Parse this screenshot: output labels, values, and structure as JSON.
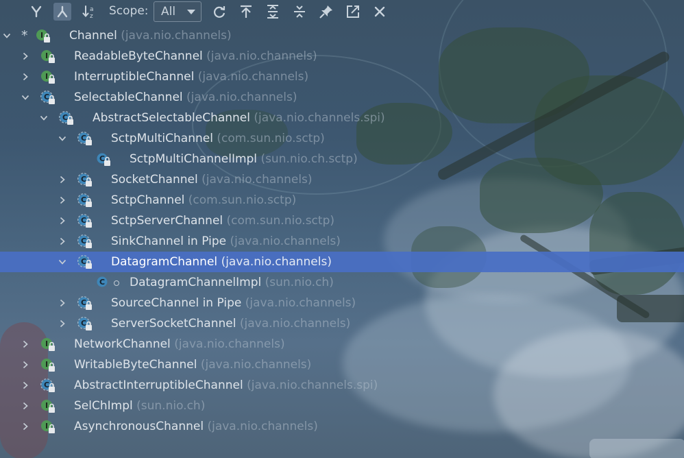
{
  "toolbar": {
    "buttons": [
      {
        "icon": "subtypes-hierarchy-icon"
      },
      {
        "icon": "supertypes-hierarchy-icon",
        "active": true
      },
      {
        "icon": "sort-alphabetically-icon"
      },
      {
        "icon": "refresh-icon"
      },
      {
        "icon": "base-on-this-class-icon"
      },
      {
        "icon": "expand-all-icon"
      },
      {
        "icon": "collapse-all-icon"
      },
      {
        "icon": "pin-tab-icon"
      },
      {
        "icon": "export-icon"
      },
      {
        "icon": "close-icon"
      }
    ],
    "scope_label": "Scope:",
    "scope_value": "All"
  },
  "colors": {
    "selection": "#496fc4",
    "interface_icon": "#4f9a55",
    "class_icon": "#3e86b8",
    "package_text": "#8c98a4"
  },
  "tree": [
    {
      "name": "Channel",
      "pkg": "(java.nio.channels)",
      "kind": "interface",
      "level": 0,
      "state": "expanded",
      "star": true
    },
    {
      "name": "ReadableByteChannel",
      "pkg": "(java.nio.channels)",
      "kind": "interface",
      "level": 1,
      "state": "collapsed"
    },
    {
      "name": "InterruptibleChannel",
      "pkg": "(java.nio.channels)",
      "kind": "interface",
      "level": 1,
      "state": "collapsed"
    },
    {
      "name": "SelectableChannel",
      "pkg": "(java.nio.channels)",
      "kind": "abstract-class",
      "level": 1,
      "state": "expanded"
    },
    {
      "name": "AbstractSelectableChannel",
      "pkg": "(java.nio.channels.spi)",
      "kind": "abstract-class",
      "level": 2,
      "state": "expanded"
    },
    {
      "name": "SctpMultiChannel",
      "pkg": "(com.sun.nio.sctp)",
      "kind": "abstract-class",
      "level": 3,
      "state": "expanded"
    },
    {
      "name": "SctpMultiChannelImpl",
      "pkg": "(sun.nio.ch.sctp)",
      "kind": "class",
      "level": 4,
      "state": "leaf"
    },
    {
      "name": "SocketChannel",
      "pkg": "(java.nio.channels)",
      "kind": "abstract-class",
      "level": 3,
      "state": "collapsed"
    },
    {
      "name": "SctpChannel",
      "pkg": "(com.sun.nio.sctp)",
      "kind": "abstract-class",
      "level": 3,
      "state": "collapsed"
    },
    {
      "name": "SctpServerChannel",
      "pkg": "(com.sun.nio.sctp)",
      "kind": "abstract-class",
      "level": 3,
      "state": "collapsed"
    },
    {
      "name": "SinkChannel in Pipe",
      "pkg": "(java.nio.channels)",
      "kind": "abstract-class",
      "level": 3,
      "state": "collapsed"
    },
    {
      "name": "DatagramChannel",
      "pkg": "(java.nio.channels)",
      "kind": "abstract-class",
      "level": 3,
      "state": "expanded",
      "selected": true
    },
    {
      "name": "DatagramChannelImpl",
      "pkg": "(sun.nio.ch)",
      "kind": "class-package-private",
      "level": 4,
      "state": "leaf"
    },
    {
      "name": "SourceChannel in Pipe",
      "pkg": "(java.nio.channels)",
      "kind": "abstract-class",
      "level": 3,
      "state": "collapsed"
    },
    {
      "name": "ServerSocketChannel",
      "pkg": "(java.nio.channels)",
      "kind": "abstract-class",
      "level": 3,
      "state": "collapsed"
    },
    {
      "name": "NetworkChannel",
      "pkg": "(java.nio.channels)",
      "kind": "interface",
      "level": 1,
      "state": "collapsed"
    },
    {
      "name": "WritableByteChannel",
      "pkg": "(java.nio.channels)",
      "kind": "interface",
      "level": 1,
      "state": "collapsed"
    },
    {
      "name": "AbstractInterruptibleChannel",
      "pkg": "(java.nio.channels.spi)",
      "kind": "abstract-class",
      "level": 1,
      "state": "collapsed"
    },
    {
      "name": "SelChImpl",
      "pkg": "(sun.nio.ch)",
      "kind": "interface",
      "level": 1,
      "state": "collapsed"
    },
    {
      "name": "AsynchronousChannel",
      "pkg": "(java.nio.channels)",
      "kind": "interface",
      "level": 1,
      "state": "collapsed"
    }
  ]
}
